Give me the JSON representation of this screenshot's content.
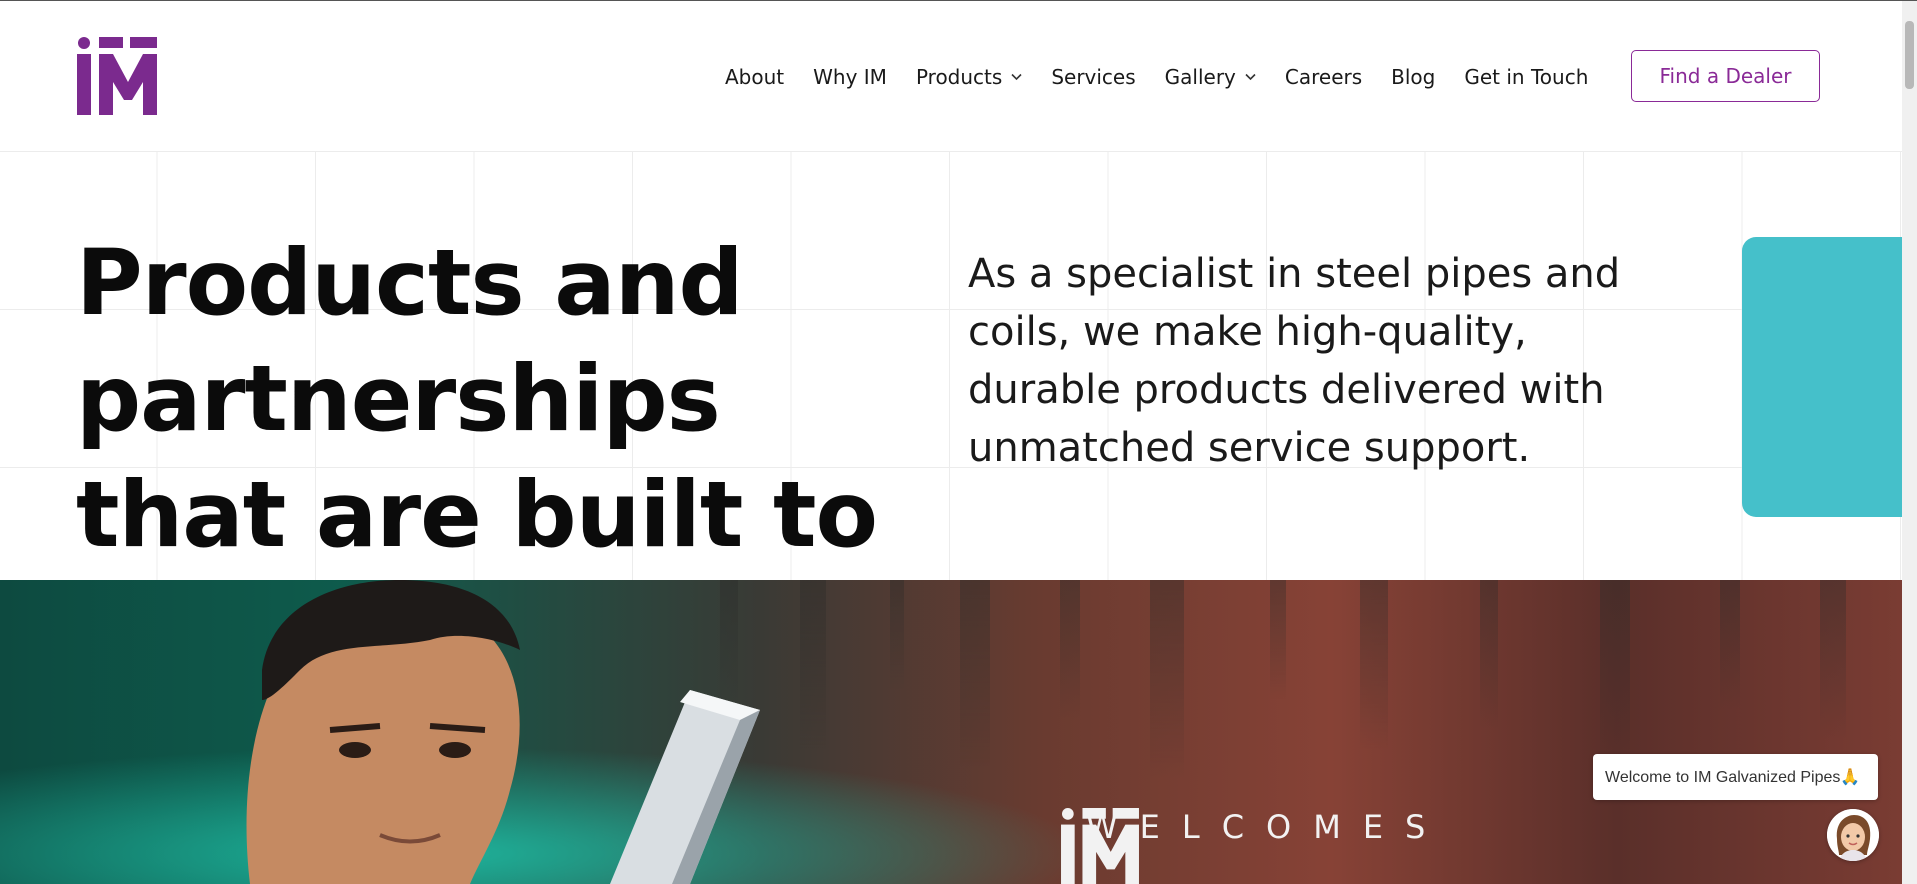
{
  "brand": {
    "logo_text": "iM",
    "accent_color": "#7b2a8e",
    "button_color": "#8a2a97",
    "teal_color": "#45c0ca"
  },
  "nav": {
    "items": [
      {
        "label": "About",
        "has_dropdown": false
      },
      {
        "label": "Why IM",
        "has_dropdown": false
      },
      {
        "label": "Products",
        "has_dropdown": true
      },
      {
        "label": "Services",
        "has_dropdown": false
      },
      {
        "label": "Gallery",
        "has_dropdown": true
      },
      {
        "label": "Careers",
        "has_dropdown": false
      },
      {
        "label": "Blog",
        "has_dropdown": false
      },
      {
        "label": "Get in Touch",
        "has_dropdown": false
      }
    ],
    "dropdown_icon": "chevron-down-icon",
    "cta_label": "Find a Dealer"
  },
  "hero": {
    "title": "Products and partnerships that are built to last",
    "description": "As a specialist in steel pipes and coils, we make high-quality, durable products delivered with unmatched service support."
  },
  "banner": {
    "logo_text": "iM",
    "welcomes_text": "WELCOMES"
  },
  "chat": {
    "greeting": "Welcome to IM Galvanized Pipes🙏",
    "avatar_icon": "assistant-avatar-icon"
  }
}
